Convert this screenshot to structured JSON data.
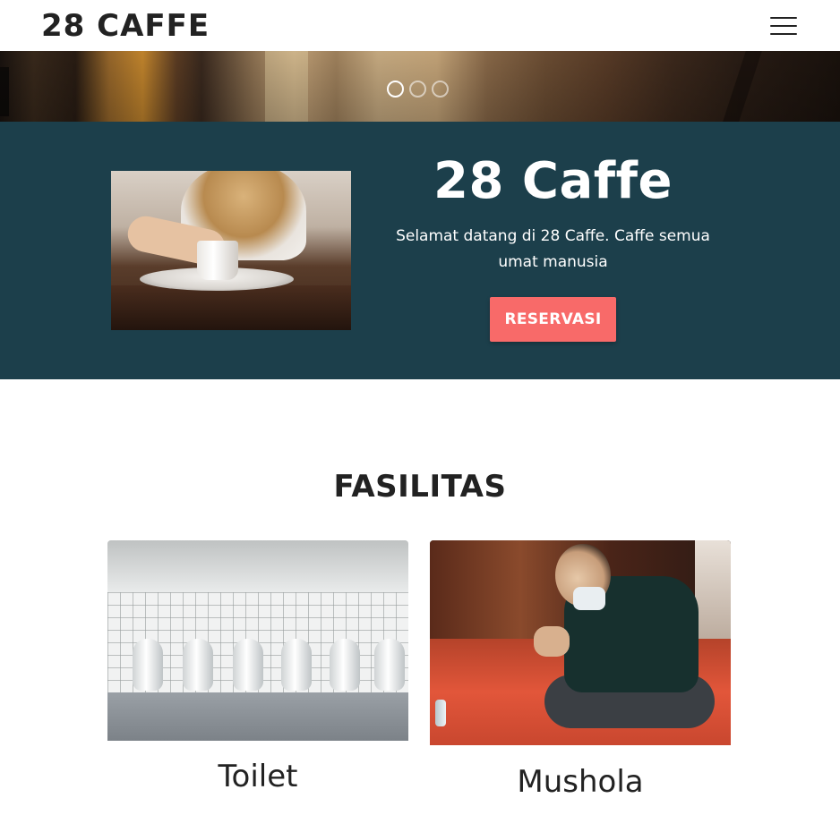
{
  "navbar": {
    "brand": "28 CAFFE",
    "menu_icon": "hamburger-menu-icon"
  },
  "carousel": {
    "indicators": 3,
    "active_index": 0
  },
  "hero": {
    "title": "28 Caffe",
    "description": "Selamat datang di 28 Caffe. Caffe semua umat manusia",
    "cta_label": "RESERVASI",
    "background_color": "#1c3f4b",
    "cta_color": "#f86a69"
  },
  "facilities": {
    "title": "FASILITAS",
    "items": [
      {
        "label": "Toilet"
      },
      {
        "label": "Mushola"
      }
    ]
  }
}
